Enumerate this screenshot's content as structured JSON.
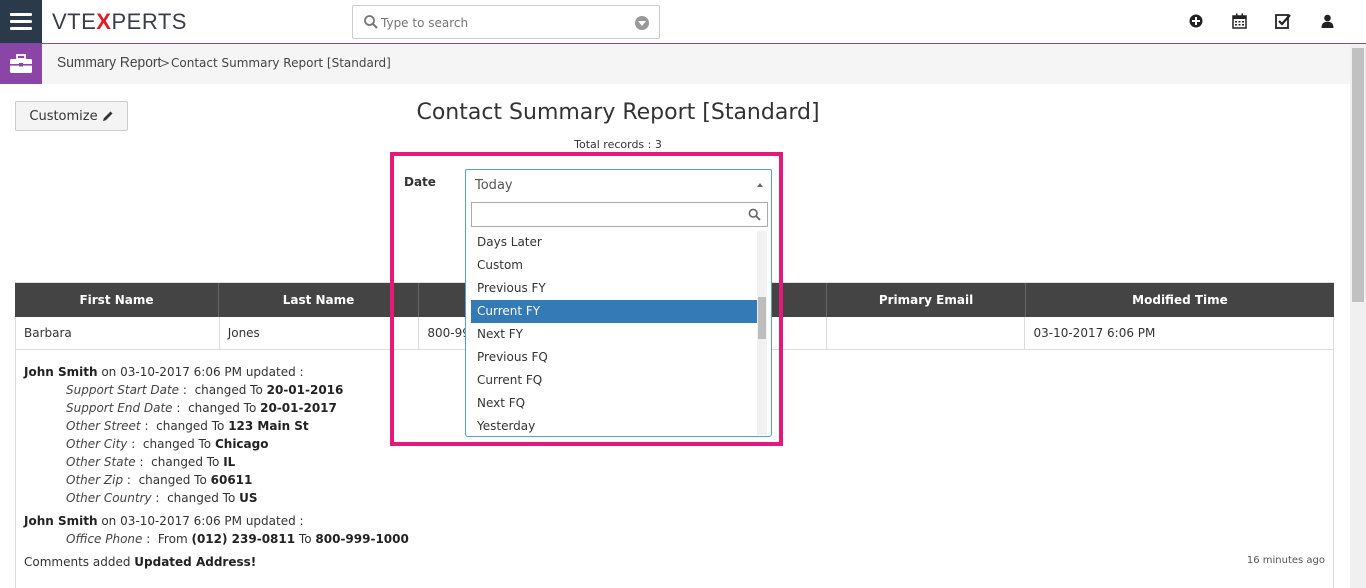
{
  "topbar": {
    "logo_left": "VTE",
    "logo_x": "X",
    "logo_right": "PERTS",
    "search_placeholder": "Type to search",
    "icons": [
      "plus-circle-icon",
      "calendar-icon",
      "check-square-icon",
      "user-icon"
    ]
  },
  "breadcrumb": {
    "module": "Summary Report",
    "separator": ">",
    "current": "Contact Summary Report [Standard]"
  },
  "toolbar": {
    "customize_label": "Customize"
  },
  "report": {
    "title": "Contact Summary Report [Standard]",
    "total": "Total records : 3"
  },
  "filter": {
    "label": "Date",
    "selected": "Today",
    "options": [
      "Days Later",
      "Custom",
      "Previous FY",
      "Current FY",
      "Next FY",
      "Previous FQ",
      "Current FQ",
      "Next FQ",
      "Yesterday"
    ],
    "highlighted_option": "Current FY"
  },
  "table": {
    "headers": [
      "First Name",
      "Last Name",
      "",
      "",
      "Primary Email",
      "Modified Time"
    ],
    "row": [
      "Barbara",
      "Jones",
      "800-99",
      "",
      "",
      "03-10-2017 6:06 PM"
    ]
  },
  "history": {
    "entry1_user": "John Smith",
    "entry1_meta": "on 03-10-2017 6:06 PM updated :",
    "entry1_changes": [
      {
        "field": "Support Start Date",
        "text": "changed To",
        "value": "20-01-2016"
      },
      {
        "field": "Support End Date",
        "text": "changed To",
        "value": "20-01-2017"
      },
      {
        "field": "Other Street",
        "text": "changed To",
        "value": "123 Main St"
      },
      {
        "field": "Other City",
        "text": "changed To",
        "value": "Chicago"
      },
      {
        "field": "Other State",
        "text": "changed To",
        "value": "IL"
      },
      {
        "field": "Other Zip",
        "text": "changed To",
        "value": "60611"
      },
      {
        "field": "Other Country",
        "text": "changed To",
        "value": "US"
      }
    ],
    "entry2_user": "John Smith",
    "entry2_meta": "on 03-10-2017 6:06 PM updated :",
    "entry2_field": "Office Phone",
    "entry2_from_label": "From",
    "entry2_from": "(012) 239-0811",
    "entry2_to_label": "To",
    "entry2_to": "800-999-1000",
    "comment_label": "Comments added",
    "comment_value": "Updated Address!",
    "time_ago": "16 minutes ago"
  },
  "colors": {
    "accent_purple": "#8b45a7",
    "highlight_pink": "#e5197a",
    "header_dark": "#444444",
    "selected_blue": "#337ab7"
  }
}
